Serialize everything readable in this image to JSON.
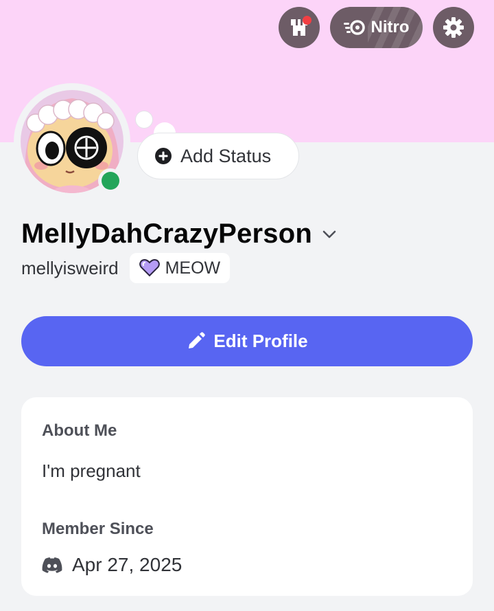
{
  "colors": {
    "banner": "#fcd4f8",
    "background": "#f2f3f5",
    "accent": "#5865f2",
    "top_button": "#6d5c66",
    "online": "#23a55a",
    "notification": "#f23f43"
  },
  "header": {
    "shop_icon": "shop-icon",
    "nitro_label": "Nitro",
    "nitro_icon": "nitro-icon",
    "settings_icon": "gear-icon"
  },
  "status": {
    "add_label": "Add Status",
    "icon": "plus-circle-icon",
    "presence": "online"
  },
  "profile": {
    "display_name": "MellyDahCrazyPerson",
    "username": "mellyisweird",
    "clan_tag": "MEOW",
    "clan_icon": "heart-badge-icon"
  },
  "actions": {
    "edit_profile_label": "Edit Profile",
    "edit_icon": "pencil-icon"
  },
  "card": {
    "about_title": "About Me",
    "about_text": "I'm pregnant",
    "member_title": "Member Since",
    "member_date": "Apr 27, 2025",
    "member_icon": "discord-icon"
  }
}
